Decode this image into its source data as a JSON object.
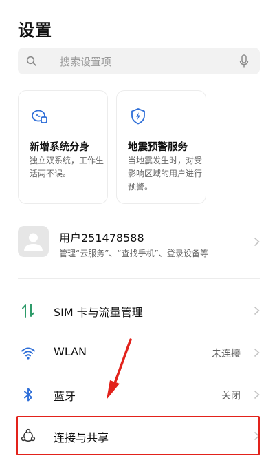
{
  "header": {
    "title": "设置"
  },
  "search": {
    "placeholder": "搜索设置项"
  },
  "cards": [
    {
      "title": "新增系统分身",
      "desc": "独立双系统，工作生活两不误。"
    },
    {
      "title": "地震预警服务",
      "desc": "当地震发生时，对受影响区域的用户进行预警。"
    }
  ],
  "account": {
    "name": "用户251478588",
    "subtitle": "管理“云服务”、“查找手机”、登录设备等"
  },
  "settings": [
    {
      "label": "SIM 卡与流量管理",
      "value": ""
    },
    {
      "label": "WLAN",
      "value": "未连接"
    },
    {
      "label": "蓝牙",
      "value": "关闭"
    },
    {
      "label": "连接与共享",
      "value": ""
    }
  ],
  "annotation": {
    "color": "#e2221b"
  }
}
